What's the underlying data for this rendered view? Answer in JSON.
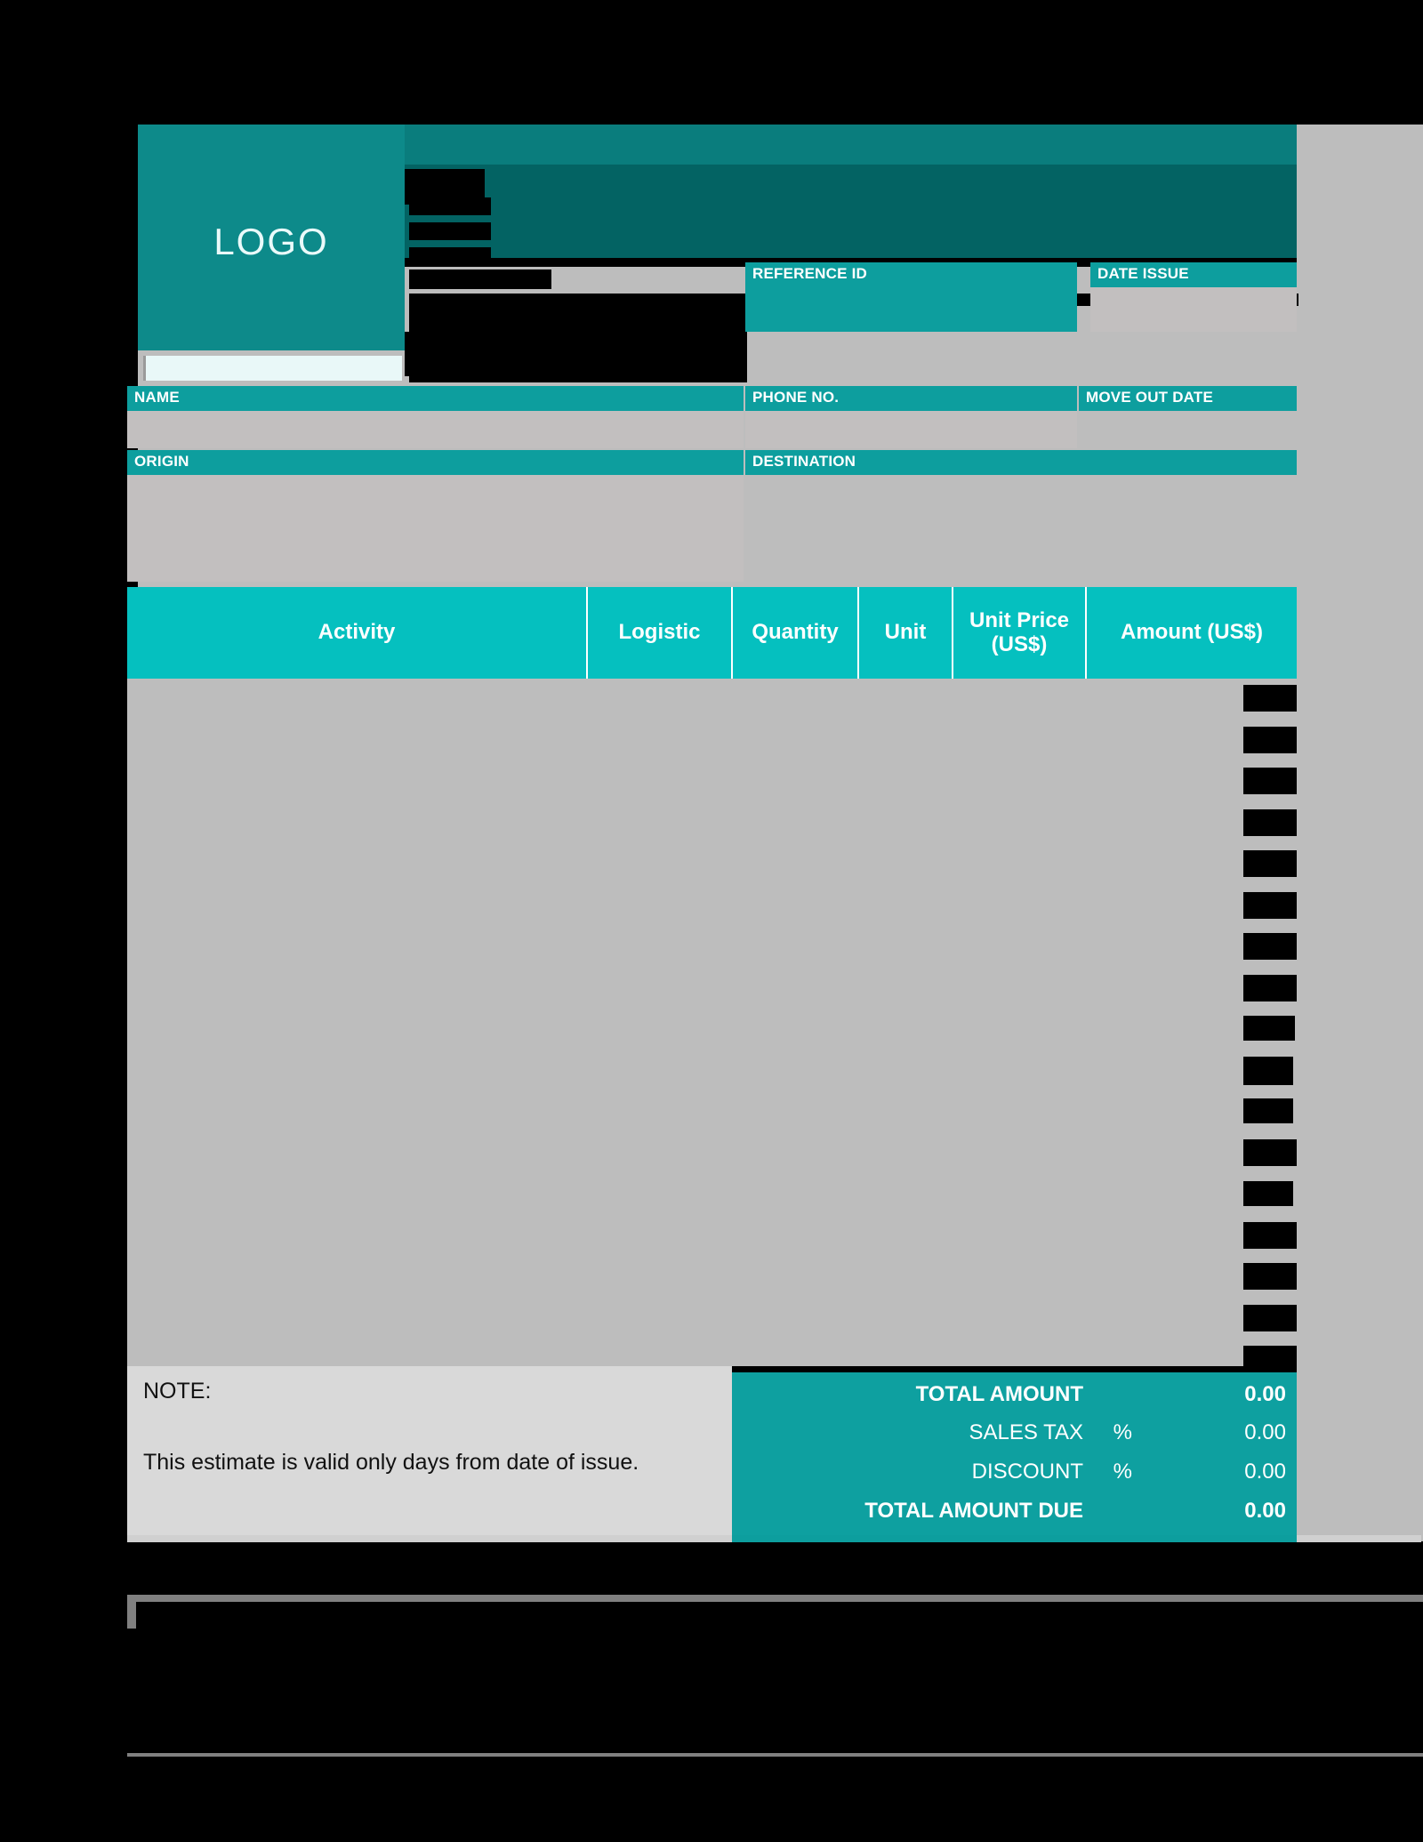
{
  "document": {
    "type": "Moving Estimate / Quotation Form",
    "logo_placeholder": "LOGO"
  },
  "header_fields": [
    {
      "label": "REFERENCE ID",
      "value": ""
    },
    {
      "label": "DATE ISSUE",
      "value": ""
    }
  ],
  "customer_fields": [
    {
      "label": "NAME",
      "value": ""
    },
    {
      "label": "PHONE NO.",
      "value": ""
    },
    {
      "label": "MOVE OUT DATE",
      "value": ""
    }
  ],
  "route_fields": [
    {
      "label": "ORIGIN",
      "value": ""
    },
    {
      "label": "DESTINATION",
      "value": ""
    }
  ],
  "items_table": {
    "columns": [
      {
        "label": "Activity"
      },
      {
        "label": "Logistic"
      },
      {
        "label": "Quantity"
      },
      {
        "label": "Unit"
      },
      {
        "label": "Unit Price\n(US$)"
      },
      {
        "label": "Amount (US$)"
      }
    ],
    "rows": []
  },
  "note": {
    "title": "NOTE:",
    "text": "This estimate is valid only          days from date of issue."
  },
  "totals": [
    {
      "label": "TOTAL AMOUNT",
      "percent": "",
      "value": "0.00",
      "emphasis": true
    },
    {
      "label": "SALES TAX",
      "percent": "%",
      "value": "0.00",
      "emphasis": false
    },
    {
      "label": "DISCOUNT",
      "percent": "%",
      "value": "0.00",
      "emphasis": false
    },
    {
      "label": "TOTAL AMOUNT DUE",
      "percent": "",
      "value": "0.00",
      "emphasis": true
    }
  ],
  "colors": {
    "brand_teal": "#0d9e9e",
    "brand_teal_dark": "#036363",
    "brand_teal_bright": "#05c0bf",
    "logo_teal": "#0d8a8a",
    "paper_grey": "#bdbdbd",
    "field_grey": "#c2bfbf",
    "note_grey": "#d9d9d9",
    "redaction": "#000000"
  }
}
